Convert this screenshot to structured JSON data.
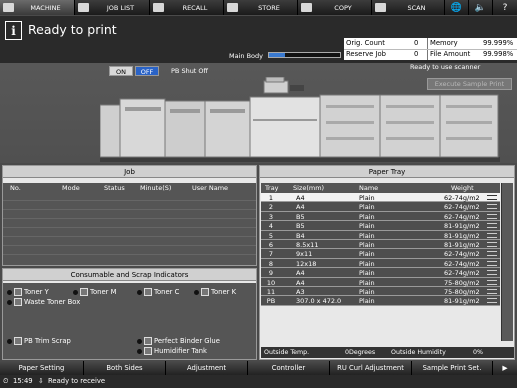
{
  "tabs": [
    {
      "label": "MACHINE",
      "icon": "machine-icon"
    },
    {
      "label": "JOB LIST",
      "icon": "job-list-icon"
    },
    {
      "label": "RECALL",
      "icon": "recall-icon"
    },
    {
      "label": "STORE",
      "icon": "store-icon"
    },
    {
      "label": "COPY",
      "icon": "copy-icon"
    },
    {
      "label": "SCAN",
      "icon": "scan-icon"
    }
  ],
  "top_icons": {
    "globe": "🌐",
    "speaker": "🔈",
    "help": "?"
  },
  "header": {
    "info_icon": "i",
    "status_text": "Ready to print",
    "main_body_label": "Main Body",
    "main_body_level": 0.22,
    "orig_count_label": "Orig. Count",
    "orig_count_value": "0",
    "reserve_job_label": "Reserve Job",
    "reserve_job_value": "0",
    "memory_label": "Memory",
    "memory_value": "99.999%",
    "file_amount_label": "File Amount",
    "file_amount_value": "99.998%"
  },
  "machine": {
    "on_label": "ON",
    "off_label": "OFF",
    "pb_shut_off_label": "PB Shut Off",
    "scanner_status": "Ready to use scanner",
    "execute_sample_label": "Execute Sample Print"
  },
  "job": {
    "title": "Job",
    "columns": [
      "No.",
      "Mode",
      "Status",
      "Minute(S)",
      "User Name"
    ]
  },
  "consumables": {
    "title": "Consumable and Scrap Indicators",
    "toner_y": "Toner Y",
    "toner_m": "Toner M",
    "toner_c": "Toner C",
    "toner_k": "Toner K",
    "waste_toner_box": "Waste Toner Box",
    "pb_trim_scrap": "PB Trim Scrap",
    "perfect_binder_glue": "Perfect Binder Glue",
    "humidifier_tank": "Humidifier Tank"
  },
  "paper_tray": {
    "title": "Paper Tray",
    "columns": [
      "Tray",
      "Size(mm)",
      "Name",
      "Weight"
    ],
    "rows": [
      {
        "tray": "1",
        "size": "A4",
        "name": "Plain",
        "weight": "62-74g/m2"
      },
      {
        "tray": "2",
        "size": "A4",
        "name": "Plain",
        "weight": "62-74g/m2"
      },
      {
        "tray": "3",
        "size": "B5",
        "name": "Plain",
        "weight": "62-74g/m2"
      },
      {
        "tray": "4",
        "size": "B5",
        "name": "Plain",
        "weight": "81-91g/m2"
      },
      {
        "tray": "5",
        "size": "B4",
        "name": "Plain",
        "weight": "81-91g/m2"
      },
      {
        "tray": "6",
        "size": "8.5x11",
        "name": "Plain",
        "weight": "81-91g/m2"
      },
      {
        "tray": "7",
        "size": "9x11",
        "name": "Plain",
        "weight": "62-74g/m2"
      },
      {
        "tray": "8",
        "size": "12x18",
        "name": "Plain",
        "weight": "62-74g/m2"
      },
      {
        "tray": "9",
        "size": "A4",
        "name": "Plain",
        "weight": "62-74g/m2"
      },
      {
        "tray": "10",
        "size": "A4",
        "name": "Plain",
        "weight": "75-80g/m2"
      },
      {
        "tray": "11",
        "size": "A3",
        "name": "Plain",
        "weight": "75-80g/m2"
      },
      {
        "tray": "PB",
        "size": "307.0 x 472.0",
        "name": "Plain",
        "weight": "81-91g/m2"
      }
    ],
    "selected_row": 0,
    "outside_temp_label": "Outside Temp.",
    "outside_temp_value": "0Degrees",
    "outside_humidity_label": "Outside Humidity",
    "outside_humidity_value": "0%"
  },
  "toolbar": [
    "Paper Setting",
    "Both Sides",
    "Adjustment",
    "Controller",
    "RU Curl Adjustment",
    "Sample Print Set."
  ],
  "status_bar": {
    "time": "15:49",
    "message": "Ready to receive"
  },
  "colors": {
    "accent_blue": "#2a63c7",
    "selected_row": "#f2f2f2"
  }
}
